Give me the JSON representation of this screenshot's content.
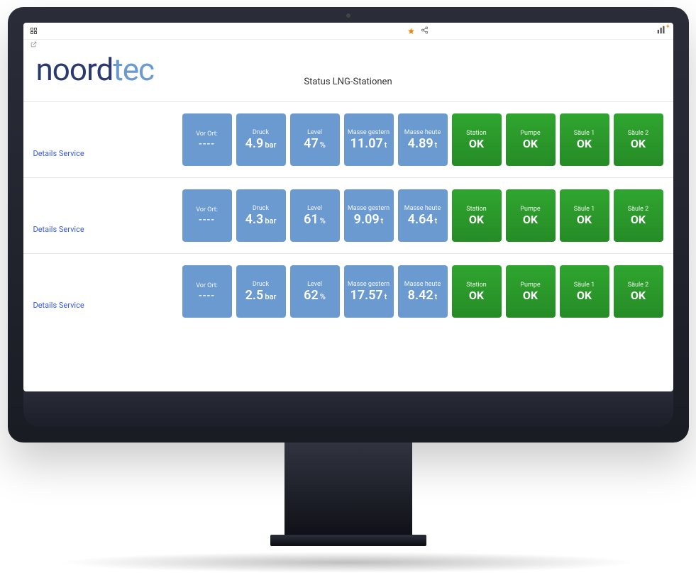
{
  "brand_part1": "noord",
  "brand_part2": "tec",
  "page_title": "Status LNG-Stationen",
  "details_label": "Details Service",
  "tile_labels": {
    "vor_ort": "Vor Ort:",
    "druck": "Druck",
    "level": "Level",
    "masse_gestern": "Masse gestern",
    "masse_heute": "Masse heute",
    "station": "Station",
    "pumpe": "Pumpe",
    "saeule1": "Säule 1",
    "saeule2": "Säule 2"
  },
  "units": {
    "bar": "bar",
    "pct": "%",
    "t": "t"
  },
  "statuses": {
    "ok": "OK"
  },
  "stations": [
    {
      "vor_ort": "----",
      "druck": "4.9",
      "level": "47",
      "masse_gestern": "11.07",
      "masse_heute": "4.89",
      "station": "OK",
      "pumpe": "OK",
      "saeule1": "OK",
      "saeule2": "OK"
    },
    {
      "vor_ort": "----",
      "druck": "4.3",
      "level": "61",
      "masse_gestern": "9.09",
      "masse_heute": "4.64",
      "station": "OK",
      "pumpe": "OK",
      "saeule1": "OK",
      "saeule2": "OK"
    },
    {
      "vor_ort": "----",
      "druck": "2.5",
      "level": "62",
      "masse_gestern": "17.57",
      "masse_heute": "8.42",
      "station": "OK",
      "pumpe": "OK",
      "saeule1": "OK",
      "saeule2": "OK"
    }
  ]
}
